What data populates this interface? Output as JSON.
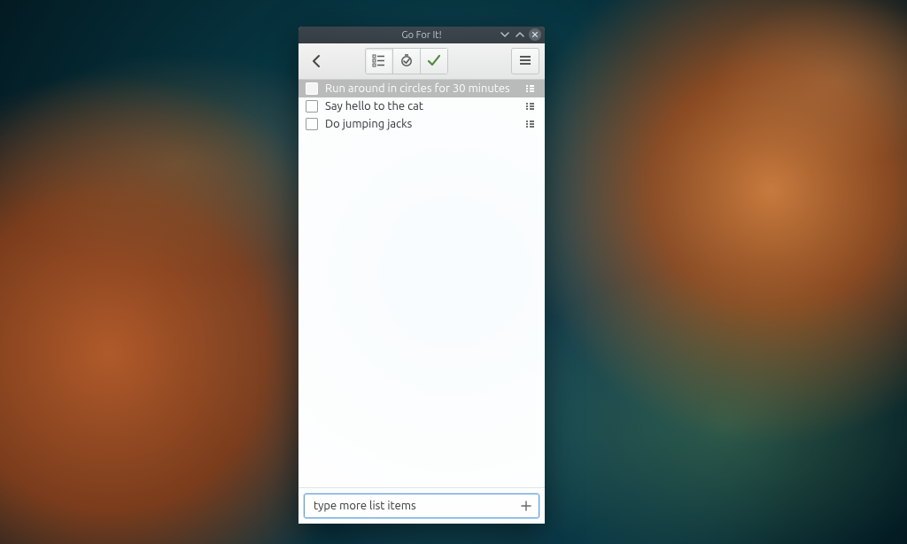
{
  "window": {
    "title": "Go For It!"
  },
  "toolbar": {
    "back": "chevron-left",
    "tabs": {
      "todo": "list-icon",
      "timer": "timer-icon",
      "done": "check-icon"
    },
    "menu": "hamburger-icon"
  },
  "tasks": [
    {
      "text": "Run around in circles for 30 minutes",
      "checked": false,
      "selected": true
    },
    {
      "text": "Say hello to the cat",
      "checked": false,
      "selected": false
    },
    {
      "text": "Do jumping jacks",
      "checked": false,
      "selected": false
    }
  ],
  "input": {
    "placeholder": "",
    "value": "type more list items"
  },
  "icons": {
    "addplus": "+"
  }
}
